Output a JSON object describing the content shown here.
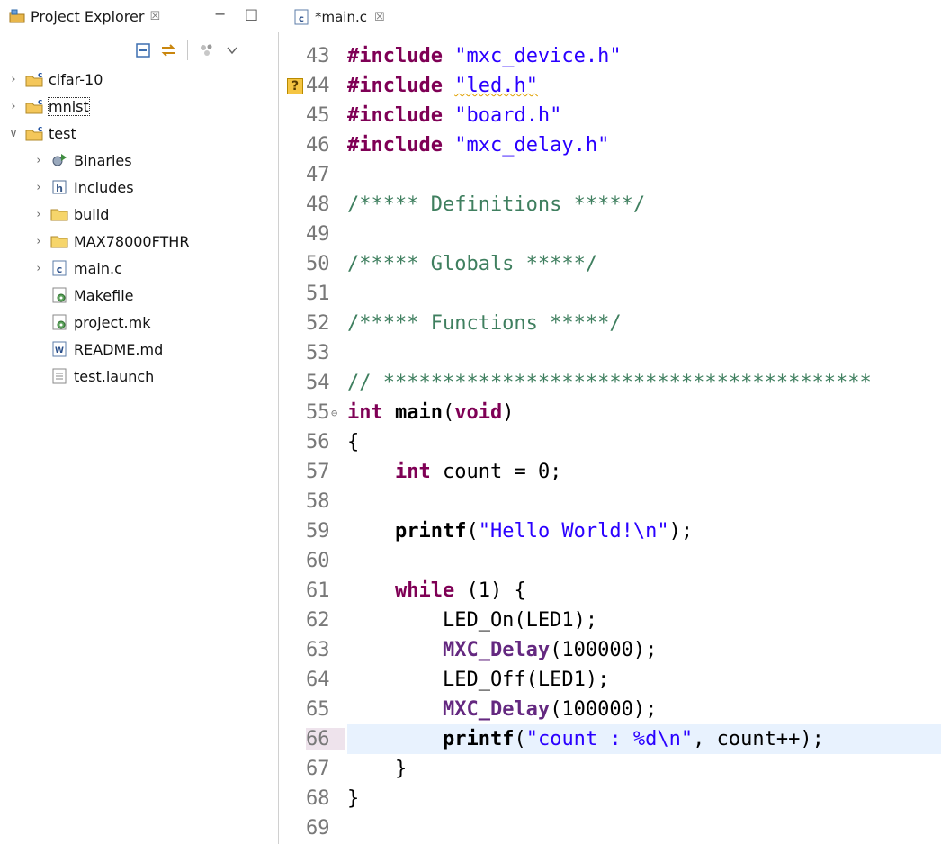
{
  "explorer": {
    "title": "Project Explorer",
    "close_glyph": "☒",
    "minimize_glyph": "−",
    "maximize_glyph": "□",
    "toolbar": [
      "collapse-all-icon",
      "link-with-editor-icon",
      "filter-icon",
      "view-menu-icon"
    ],
    "tree": [
      {
        "label": "cifar-10",
        "icon": "c-project-icon",
        "twisty": "›",
        "depth": 0
      },
      {
        "label": "mnist",
        "icon": "c-project-icon",
        "twisty": "›",
        "depth": 0,
        "focused": true
      },
      {
        "label": "test",
        "icon": "c-project-icon",
        "twisty": "∨",
        "depth": 0
      },
      {
        "label": "Binaries",
        "icon": "binaries-icon",
        "twisty": "›",
        "depth": 1
      },
      {
        "label": "Includes",
        "icon": "includes-icon",
        "twisty": "›",
        "depth": 1
      },
      {
        "label": "build",
        "icon": "folder-icon",
        "twisty": "›",
        "depth": 1
      },
      {
        "label": "MAX78000FTHR",
        "icon": "folder-icon",
        "twisty": "›",
        "depth": 1
      },
      {
        "label": "main.c",
        "icon": "c-file-icon",
        "twisty": "›",
        "depth": 1
      },
      {
        "label": "Makefile",
        "icon": "makefile-icon",
        "twisty": "",
        "depth": 1
      },
      {
        "label": "project.mk",
        "icon": "makefile-icon",
        "twisty": "",
        "depth": 1
      },
      {
        "label": "README.md",
        "icon": "markdown-file-icon",
        "twisty": "",
        "depth": 1
      },
      {
        "label": "test.launch",
        "icon": "text-file-icon",
        "twisty": "",
        "depth": 1
      }
    ]
  },
  "editor": {
    "tab_label": "*main.c",
    "close_glyph": "☒",
    "current_line": 66,
    "lines": [
      {
        "n": "43",
        "tokens": [
          [
            "kw",
            "#include"
          ],
          [
            "",
            " "
          ],
          [
            "str",
            "\"mxc_device.h\""
          ]
        ]
      },
      {
        "n": "44",
        "warn": true,
        "tokens": [
          [
            "kw",
            "#include"
          ],
          [
            "",
            " "
          ],
          [
            "str squiggle",
            "\"led.h\""
          ]
        ]
      },
      {
        "n": "45",
        "tokens": [
          [
            "kw",
            "#include"
          ],
          [
            "",
            " "
          ],
          [
            "str",
            "\"board.h\""
          ]
        ]
      },
      {
        "n": "46",
        "tokens": [
          [
            "kw",
            "#include"
          ],
          [
            "",
            " "
          ],
          [
            "str",
            "\"mxc_delay.h\""
          ]
        ]
      },
      {
        "n": "47",
        "tokens": []
      },
      {
        "n": "48",
        "tokens": [
          [
            "cmt",
            "/***** Definitions *****/"
          ]
        ]
      },
      {
        "n": "49",
        "tokens": []
      },
      {
        "n": "50",
        "tokens": [
          [
            "cmt",
            "/***** Globals *****/"
          ]
        ]
      },
      {
        "n": "51",
        "tokens": []
      },
      {
        "n": "52",
        "tokens": [
          [
            "cmt",
            "/***** Functions *****/"
          ]
        ]
      },
      {
        "n": "53",
        "tokens": []
      },
      {
        "n": "54",
        "tokens": [
          [
            "cmt",
            "// *****************************************"
          ]
        ]
      },
      {
        "n": "55",
        "fold": true,
        "tokens": [
          [
            "kw",
            "int"
          ],
          [
            "",
            " "
          ],
          [
            "fn",
            "main"
          ],
          [
            "",
            "("
          ],
          [
            "kw",
            "void"
          ],
          [
            "",
            ")"
          ]
        ]
      },
      {
        "n": "56",
        "tokens": [
          [
            "",
            "{"
          ]
        ]
      },
      {
        "n": "57",
        "tokens": [
          [
            "",
            "    "
          ],
          [
            "kw",
            "int"
          ],
          [
            "",
            " count = 0;"
          ]
        ]
      },
      {
        "n": "58",
        "tokens": []
      },
      {
        "n": "59",
        "tokens": [
          [
            "",
            "    "
          ],
          [
            "fn",
            "printf"
          ],
          [
            "",
            "("
          ],
          [
            "str",
            "\"Hello World!\\n\""
          ],
          [
            "",
            ");"
          ]
        ]
      },
      {
        "n": "60",
        "tokens": []
      },
      {
        "n": "61",
        "tokens": [
          [
            "",
            "    "
          ],
          [
            "kw",
            "while"
          ],
          [
            "",
            " (1) {"
          ]
        ]
      },
      {
        "n": "62",
        "tokens": [
          [
            "",
            "        LED_On(LED1);"
          ]
        ]
      },
      {
        "n": "63",
        "tokens": [
          [
            "",
            "        "
          ],
          [
            "mac",
            "MXC_Delay"
          ],
          [
            "",
            "(100000);"
          ]
        ]
      },
      {
        "n": "64",
        "tokens": [
          [
            "",
            "        LED_Off(LED1);"
          ]
        ]
      },
      {
        "n": "65",
        "tokens": [
          [
            "",
            "        "
          ],
          [
            "mac",
            "MXC_Delay"
          ],
          [
            "",
            "(100000);"
          ]
        ]
      },
      {
        "n": "66",
        "tokens": [
          [
            "",
            "        "
          ],
          [
            "fn",
            "printf"
          ],
          [
            "",
            "("
          ],
          [
            "str",
            "\"count : %d\\n\""
          ],
          [
            "",
            ", count++);"
          ]
        ]
      },
      {
        "n": "67",
        "tokens": [
          [
            "",
            "    }"
          ]
        ]
      },
      {
        "n": "68",
        "tokens": [
          [
            "",
            "}"
          ]
        ]
      },
      {
        "n": "69",
        "tokens": []
      }
    ]
  },
  "colors": {
    "keyword": "#7f0055",
    "string": "#2a00ff",
    "comment": "#3f7f5f",
    "current_line_bg": "#e8f2fe",
    "warning_marker": "#f5c542"
  }
}
